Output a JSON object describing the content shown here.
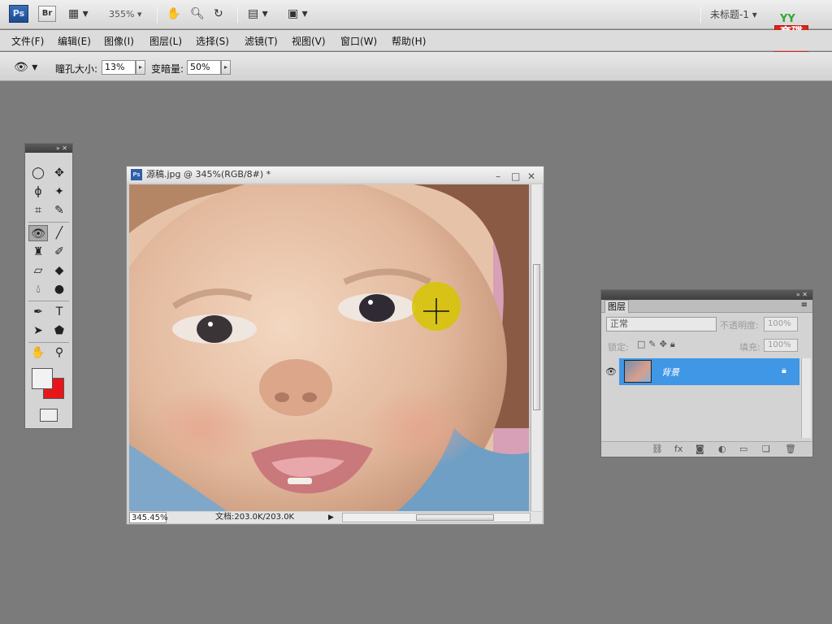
{
  "appbar": {
    "ps_logo": "Ps",
    "br_logo": "Br",
    "zoom": "355%",
    "doc_title": "未标题-1"
  },
  "badge": {
    "top": "YY",
    "line1": "育",
    "line2": "碟",
    "line3": "教",
    "line4": "育"
  },
  "menu": [
    {
      "label": "文件(F)"
    },
    {
      "label": "编辑(E)"
    },
    {
      "label": "图像(I)"
    },
    {
      "label": "图层(L)"
    },
    {
      "label": "选择(S)"
    },
    {
      "label": "滤镜(T)"
    },
    {
      "label": "视图(V)"
    },
    {
      "label": "窗口(W)"
    },
    {
      "label": "帮助(H)"
    }
  ],
  "options": {
    "pupil_label": "瞳孔大小:",
    "pupil_value": "13%",
    "darken_label": "变暗量:",
    "darken_value": "50%"
  },
  "document": {
    "title": "源稿.jpg @ 345%(RGB/8#) *",
    "zoom": "345.45%",
    "doc_size": "文档:203.0K/203.0K"
  },
  "layers": {
    "tab": "图层",
    "blend_mode": "正常",
    "opacity_label": "不透明度:",
    "opacity_value": "100%",
    "lock_label": "锁定:",
    "fill_label": "填充:",
    "fill_value": "100%",
    "layer_name": "背景"
  }
}
